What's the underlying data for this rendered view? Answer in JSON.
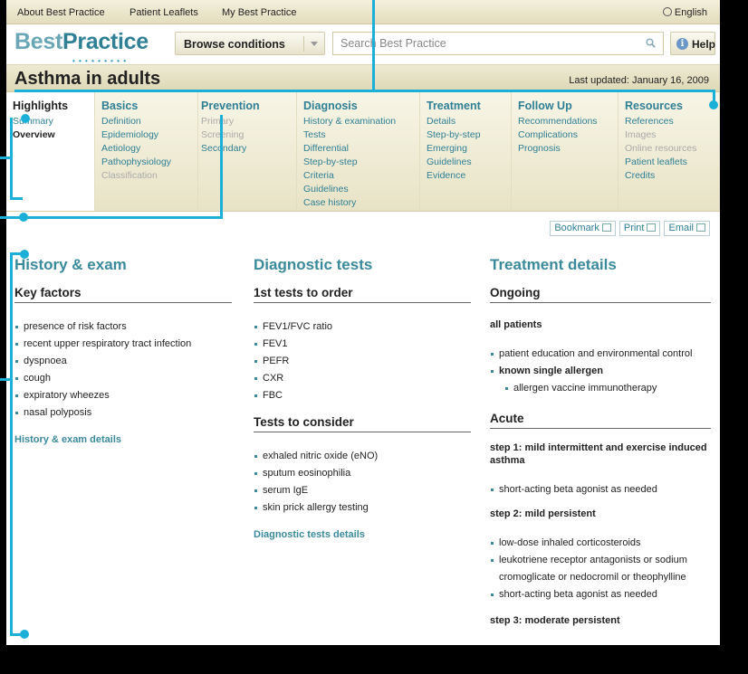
{
  "topbar": {
    "links": [
      "About Best Practice",
      "Patient Leaflets",
      "My Best Practice"
    ],
    "language": "English"
  },
  "header": {
    "logo_part1": "Best",
    "logo_part2": "Practice",
    "browse_label": "Browse conditions",
    "search_placeholder": "Search Best Practice",
    "help_label": "Help"
  },
  "titlebar": {
    "title": "Asthma in adults",
    "last_updated": "Last updated: January 16, 2009"
  },
  "nav": [
    {
      "heading": "Highlights",
      "items": [
        {
          "label": "Summary",
          "state": "link"
        },
        {
          "label": "Overview",
          "state": "current"
        }
      ]
    },
    {
      "heading": "Basics",
      "items": [
        {
          "label": "Definition",
          "state": "link"
        },
        {
          "label": "Epidemiology",
          "state": "link"
        },
        {
          "label": "Aetiology",
          "state": "link"
        },
        {
          "label": "Pathophysiology",
          "state": "link"
        },
        {
          "label": "Classification",
          "state": "dim"
        }
      ]
    },
    {
      "heading": "Prevention",
      "items": [
        {
          "label": "Primary",
          "state": "dim"
        },
        {
          "label": "Screening",
          "state": "dim"
        },
        {
          "label": "Secondary",
          "state": "link"
        }
      ]
    },
    {
      "heading": "Diagnosis",
      "items": [
        {
          "label": "History & examination",
          "state": "link"
        },
        {
          "label": "Tests",
          "state": "link"
        },
        {
          "label": "Differential",
          "state": "link"
        },
        {
          "label": "Step-by-step",
          "state": "link"
        },
        {
          "label": "Criteria",
          "state": "link"
        },
        {
          "label": "Guidelines",
          "state": "link"
        },
        {
          "label": "Case history",
          "state": "link"
        }
      ]
    },
    {
      "heading": "Treatment",
      "items": [
        {
          "label": "Details",
          "state": "link"
        },
        {
          "label": "Step-by-step",
          "state": "link"
        },
        {
          "label": "Emerging",
          "state": "link"
        },
        {
          "label": "Guidelines",
          "state": "link"
        },
        {
          "label": "Evidence",
          "state": "link"
        }
      ]
    },
    {
      "heading": "Follow Up",
      "items": [
        {
          "label": "Recommendations",
          "state": "link"
        },
        {
          "label": "Complications",
          "state": "link"
        },
        {
          "label": "Prognosis",
          "state": "link"
        }
      ]
    },
    {
      "heading": "Resources",
      "items": [
        {
          "label": "References",
          "state": "link"
        },
        {
          "label": "Images",
          "state": "dim"
        },
        {
          "label": "Online resources",
          "state": "dim"
        },
        {
          "label": "Patient leaflets",
          "state": "link"
        },
        {
          "label": "Credits",
          "state": "link"
        }
      ]
    }
  ],
  "tools": {
    "bookmark": "Bookmark",
    "print": "Print",
    "email": "Email"
  },
  "history": {
    "title": "History & exam",
    "key_factors_heading": "Key factors",
    "key_factors": [
      "presence of risk factors",
      "recent upper respiratory tract infection",
      "dyspnoea",
      "cough",
      "expiratory wheezes",
      "nasal polyposis"
    ],
    "details_link": "History & exam details"
  },
  "diagnostic": {
    "title": "Diagnostic tests",
    "first_heading": "1st tests to order",
    "first": [
      "FEV1/FVC ratio",
      "FEV1",
      "PEFR",
      "CXR",
      "FBC"
    ],
    "consider_heading": "Tests to consider",
    "consider": [
      "exhaled nitric oxide (eNO)",
      "sputum eosinophilia",
      "serum IgE",
      "skin prick allergy testing"
    ],
    "details_link": "Diagnostic tests details"
  },
  "treatment": {
    "title": "Treatment details",
    "ongoing_heading": "Ongoing",
    "all_patients": "all patients",
    "ongoing_1": "patient education and environmental control",
    "ongoing_2": "known single allergen",
    "ongoing_3": "allergen vaccine immunotherapy",
    "acute_heading": "Acute",
    "step1": "step 1: mild intermittent and exercise induced asthma",
    "step1_a": "short-acting beta agonist as needed",
    "step2": "step 2: mild persistent",
    "step2_a": "low-dose inhaled corticosteroids",
    "step2_b1": "leukotriene receptor antagonists or sodium",
    "step2_b2": "cromoglicate or nedocromil or theophylline",
    "step2_c": "short-acting beta agonist as needed",
    "step3": "step 3: moderate persistent"
  },
  "colors": {
    "accent": "#3a8a9c",
    "link": "#2f7f95",
    "callout": "#1cb0d8"
  }
}
